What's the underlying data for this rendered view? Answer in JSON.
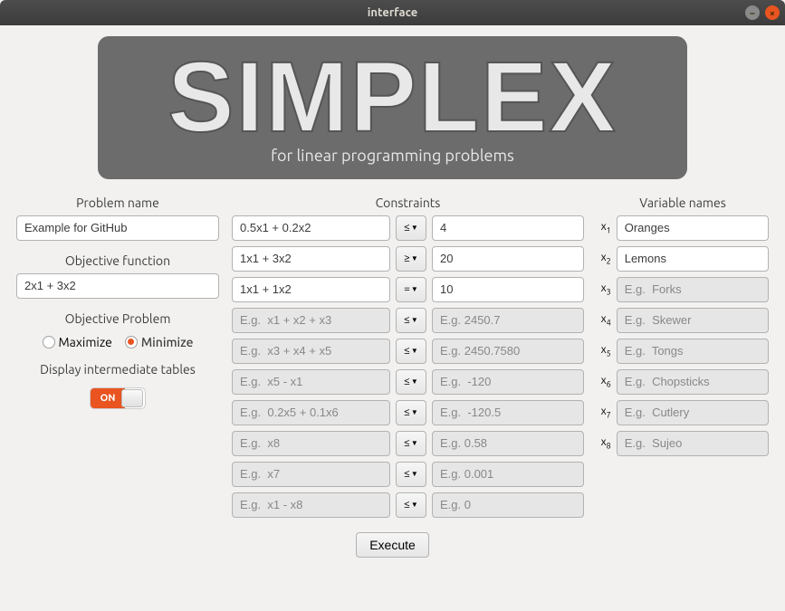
{
  "window": {
    "title": "interface"
  },
  "banner": {
    "title": "SIMPLEX",
    "subtitle": "for linear programming problems"
  },
  "left": {
    "problem_name_label": "Problem name",
    "problem_name_value": "Example for GitHub",
    "objective_function_label": "Objective function",
    "objective_function_value": "2x1 + 3x2",
    "objective_problem_label": "Objective Problem",
    "maximize_label": "Maximize",
    "minimize_label": "Minimize",
    "objective_selected": "minimize",
    "display_tables_label": "Display intermediate tables",
    "toggle_on_label": "ON",
    "toggle_state": "on"
  },
  "constraints": {
    "label": "Constraints",
    "rows": [
      {
        "expr": "0.5x1 + 0.2x2",
        "rel": "≤",
        "rhs": "4",
        "enabled": true
      },
      {
        "expr": "1x1 + 3x2",
        "rel": "≥",
        "rhs": "20",
        "enabled": true
      },
      {
        "expr": "1x1 + 1x2",
        "rel": "=",
        "rhs": "10",
        "enabled": true
      },
      {
        "expr_ph": "E.g.  x1 + x2 + x3",
        "rel": "≤",
        "rhs_ph": "E.g. 2450.7",
        "enabled": false
      },
      {
        "expr_ph": "E.g.  x3 + x4 + x5",
        "rel": "≤",
        "rhs_ph": "E.g. 2450.7580",
        "enabled": false
      },
      {
        "expr_ph": "E.g.  x5 - x1",
        "rel": "≤",
        "rhs_ph": "E.g.  -120",
        "enabled": false
      },
      {
        "expr_ph": "E.g.  0.2x5 + 0.1x6",
        "rel": "≤",
        "rhs_ph": "E.g.  -120.5",
        "enabled": false
      },
      {
        "expr_ph": "E.g.  x8",
        "rel": "≤",
        "rhs_ph": "E.g. 0.58",
        "enabled": false
      },
      {
        "expr_ph": "E.g.  x7",
        "rel": "≤",
        "rhs_ph": "E.g. 0.001",
        "enabled": false
      },
      {
        "expr_ph": "E.g.  x1 - x8",
        "rel": "≤",
        "rhs_ph": "E.g. 0",
        "enabled": false
      }
    ]
  },
  "variables": {
    "label": "Variable names",
    "rows": [
      {
        "idx": "1",
        "value": "Oranges"
      },
      {
        "idx": "2",
        "value": "Lemons"
      },
      {
        "idx": "3",
        "placeholder": "E.g.  Forks"
      },
      {
        "idx": "4",
        "placeholder": "E.g.  Skewer"
      },
      {
        "idx": "5",
        "placeholder": "E.g.  Tongs"
      },
      {
        "idx": "6",
        "placeholder": "E.g.  Chopsticks"
      },
      {
        "idx": "7",
        "placeholder": "E.g.  Cutlery"
      },
      {
        "idx": "8",
        "placeholder": "E.g.  Sujeo"
      }
    ]
  },
  "execute_label": "Execute"
}
